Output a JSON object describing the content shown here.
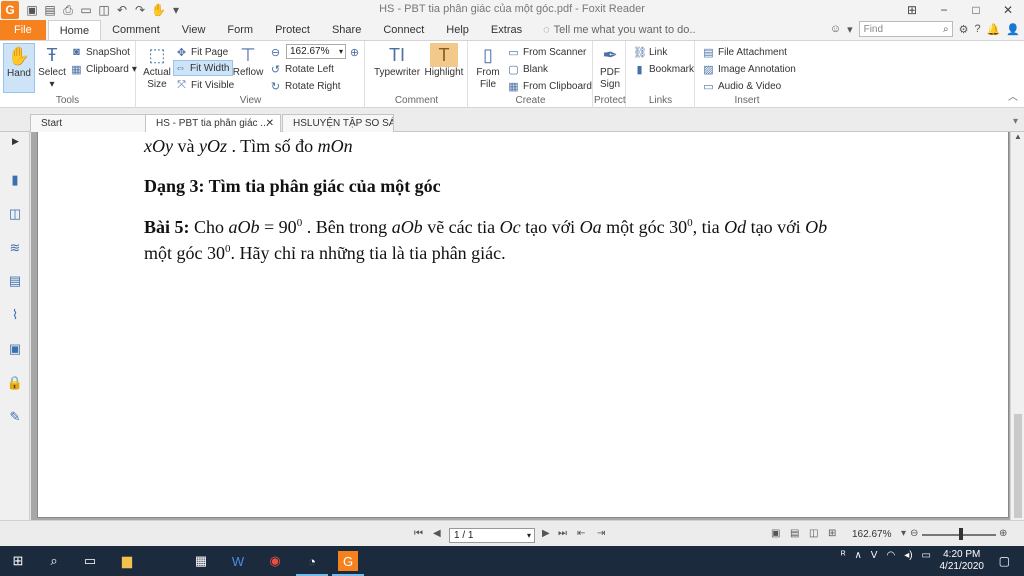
{
  "titlebar": {
    "app_logo": "G",
    "title": "HS - PBT tia phân giác của một góc.pdf - Foxit Reader",
    "qat_icons": [
      "save-icon",
      "save-as-icon",
      "print-icon",
      "open-icon",
      "new-icon",
      "undo-icon",
      "redo-icon",
      "hand-icon"
    ]
  },
  "tabs": {
    "file": "File",
    "items": [
      "Home",
      "Comment",
      "View",
      "Form",
      "Protect",
      "Share",
      "Connect",
      "Help",
      "Extras"
    ],
    "active": "Home",
    "tellme": "Tell me what you want to do..",
    "find_placeholder": "Find"
  },
  "ribbon": {
    "tools": {
      "label": "Tools",
      "hand": "Hand",
      "select": "Select",
      "snapshot": "SnapShot",
      "clipboard": "Clipboard"
    },
    "view": {
      "label": "View",
      "actual_size": "Actual Size",
      "fit_page": "Fit Page",
      "fit_width": "Fit Width",
      "fit_visible": "Fit Visible",
      "reflow": "Reflow",
      "zoom": "162.67%",
      "rotate_left": "Rotate Left",
      "rotate_right": "Rotate Right"
    },
    "comment": {
      "label": "Comment",
      "typewriter": "Typewriter",
      "highlight": "Highlight"
    },
    "create": {
      "label": "Create",
      "from_file": "From File",
      "from_scanner": "From Scanner",
      "blank": "Blank",
      "from_clipboard": "From Clipboard"
    },
    "protect": {
      "label": "Protect",
      "pdf_sign": "PDF Sign"
    },
    "links": {
      "label": "Links",
      "link": "Link",
      "bookmark": "Bookmark"
    },
    "insert": {
      "label": "Insert",
      "file_attachment": "File Attachment",
      "image_annotation": "Image Annotation",
      "audio_video": "Audio & Video"
    }
  },
  "doc_tabs": [
    {
      "label": "Start",
      "active": false
    },
    {
      "label": "HS - PBT tia phân giác ...",
      "active": true
    },
    {
      "label": "HSLUYỆN TẬP SO SÁ...",
      "active": false
    }
  ],
  "document": {
    "line1": {
      "a": "xOy",
      "b": " và ",
      "c": "yOz",
      "d": " . Tìm số đo ",
      "e": "mOn"
    },
    "heading": "Dạng 3: Tìm tia phân giác của một góc",
    "bai5": {
      "label": "Bài 5:",
      "t1": " Cho ",
      "m1": "aOb",
      "t2": " = 90",
      "sup1": "0",
      "t3": " . Bên trong ",
      "m2": "aOb",
      "t4": " vẽ các tia ",
      "m3": "Oc",
      "t5": " tạo với ",
      "m4": "Oa",
      "t6": " một góc 30",
      "sup2": "0",
      "t7": ", tia ",
      "m5": "Od",
      "t8": " tạo với ",
      "m6": "Ob",
      "line2a": "một góc 30",
      "sup3": "0",
      "line2b": ". Hãy chỉ ra những tia là tia phân giác."
    }
  },
  "statusbar": {
    "page": "1 / 1",
    "zoom": "162.67%",
    "zoom_slider_level": 0.53
  },
  "taskbar": {
    "time": "4:20 PM",
    "date": "4/21/2020",
    "items": [
      "windows-icon",
      "search-icon",
      "task-view-icon",
      "file-explorer-icon",
      "calculator-icon",
      "word-icon",
      "chrome-icon",
      "messenger-icon",
      "foxit-icon"
    ]
  }
}
